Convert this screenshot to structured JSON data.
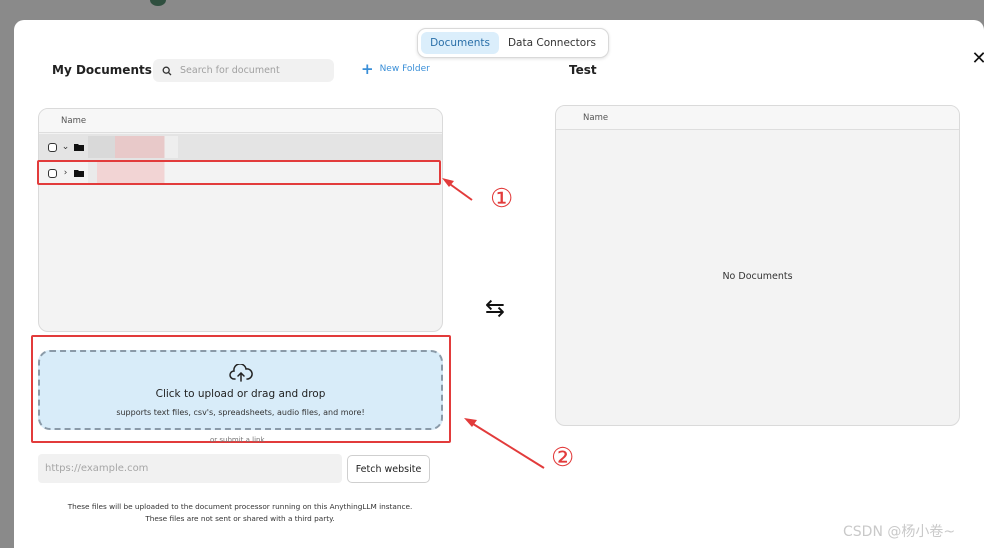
{
  "tabs": [
    {
      "label": "Documents",
      "active": true
    },
    {
      "label": "Data Connectors",
      "active": false
    }
  ],
  "close": {
    "icon": "close-icon",
    "glyph": "✕"
  },
  "left": {
    "title": "My Documents",
    "search": {
      "placeholder": "Search for document",
      "value": ""
    },
    "new_folder_label": "New Folder",
    "table_header": "Name",
    "rows": [
      {
        "expanded": true,
        "chevron": "⌄"
      },
      {
        "expanded": false,
        "chevron": "›"
      }
    ]
  },
  "right": {
    "title": "Test",
    "table_header": "Name",
    "empty_text": "No Documents"
  },
  "swap_glyph": "⇆",
  "upload": {
    "title": "Click to upload or drag and drop",
    "subtitle": "supports text files, csv's, spreadsheets, audio files, and more!",
    "or_link": "or submit a link"
  },
  "link": {
    "placeholder": "https://example.com",
    "button_label": "Fetch website"
  },
  "notes": [
    "These files will be uploaded to the document processor running on this AnythingLLM instance.",
    "These files are not sent or shared with a third party."
  ],
  "annotations": {
    "marker1": "①",
    "marker2": "②"
  },
  "watermark": "CSDN @杨小卷~",
  "colors": {
    "accent": "#3a8fd8",
    "annotation": "#e23b3b",
    "dropzone": "#d8ecf9"
  }
}
